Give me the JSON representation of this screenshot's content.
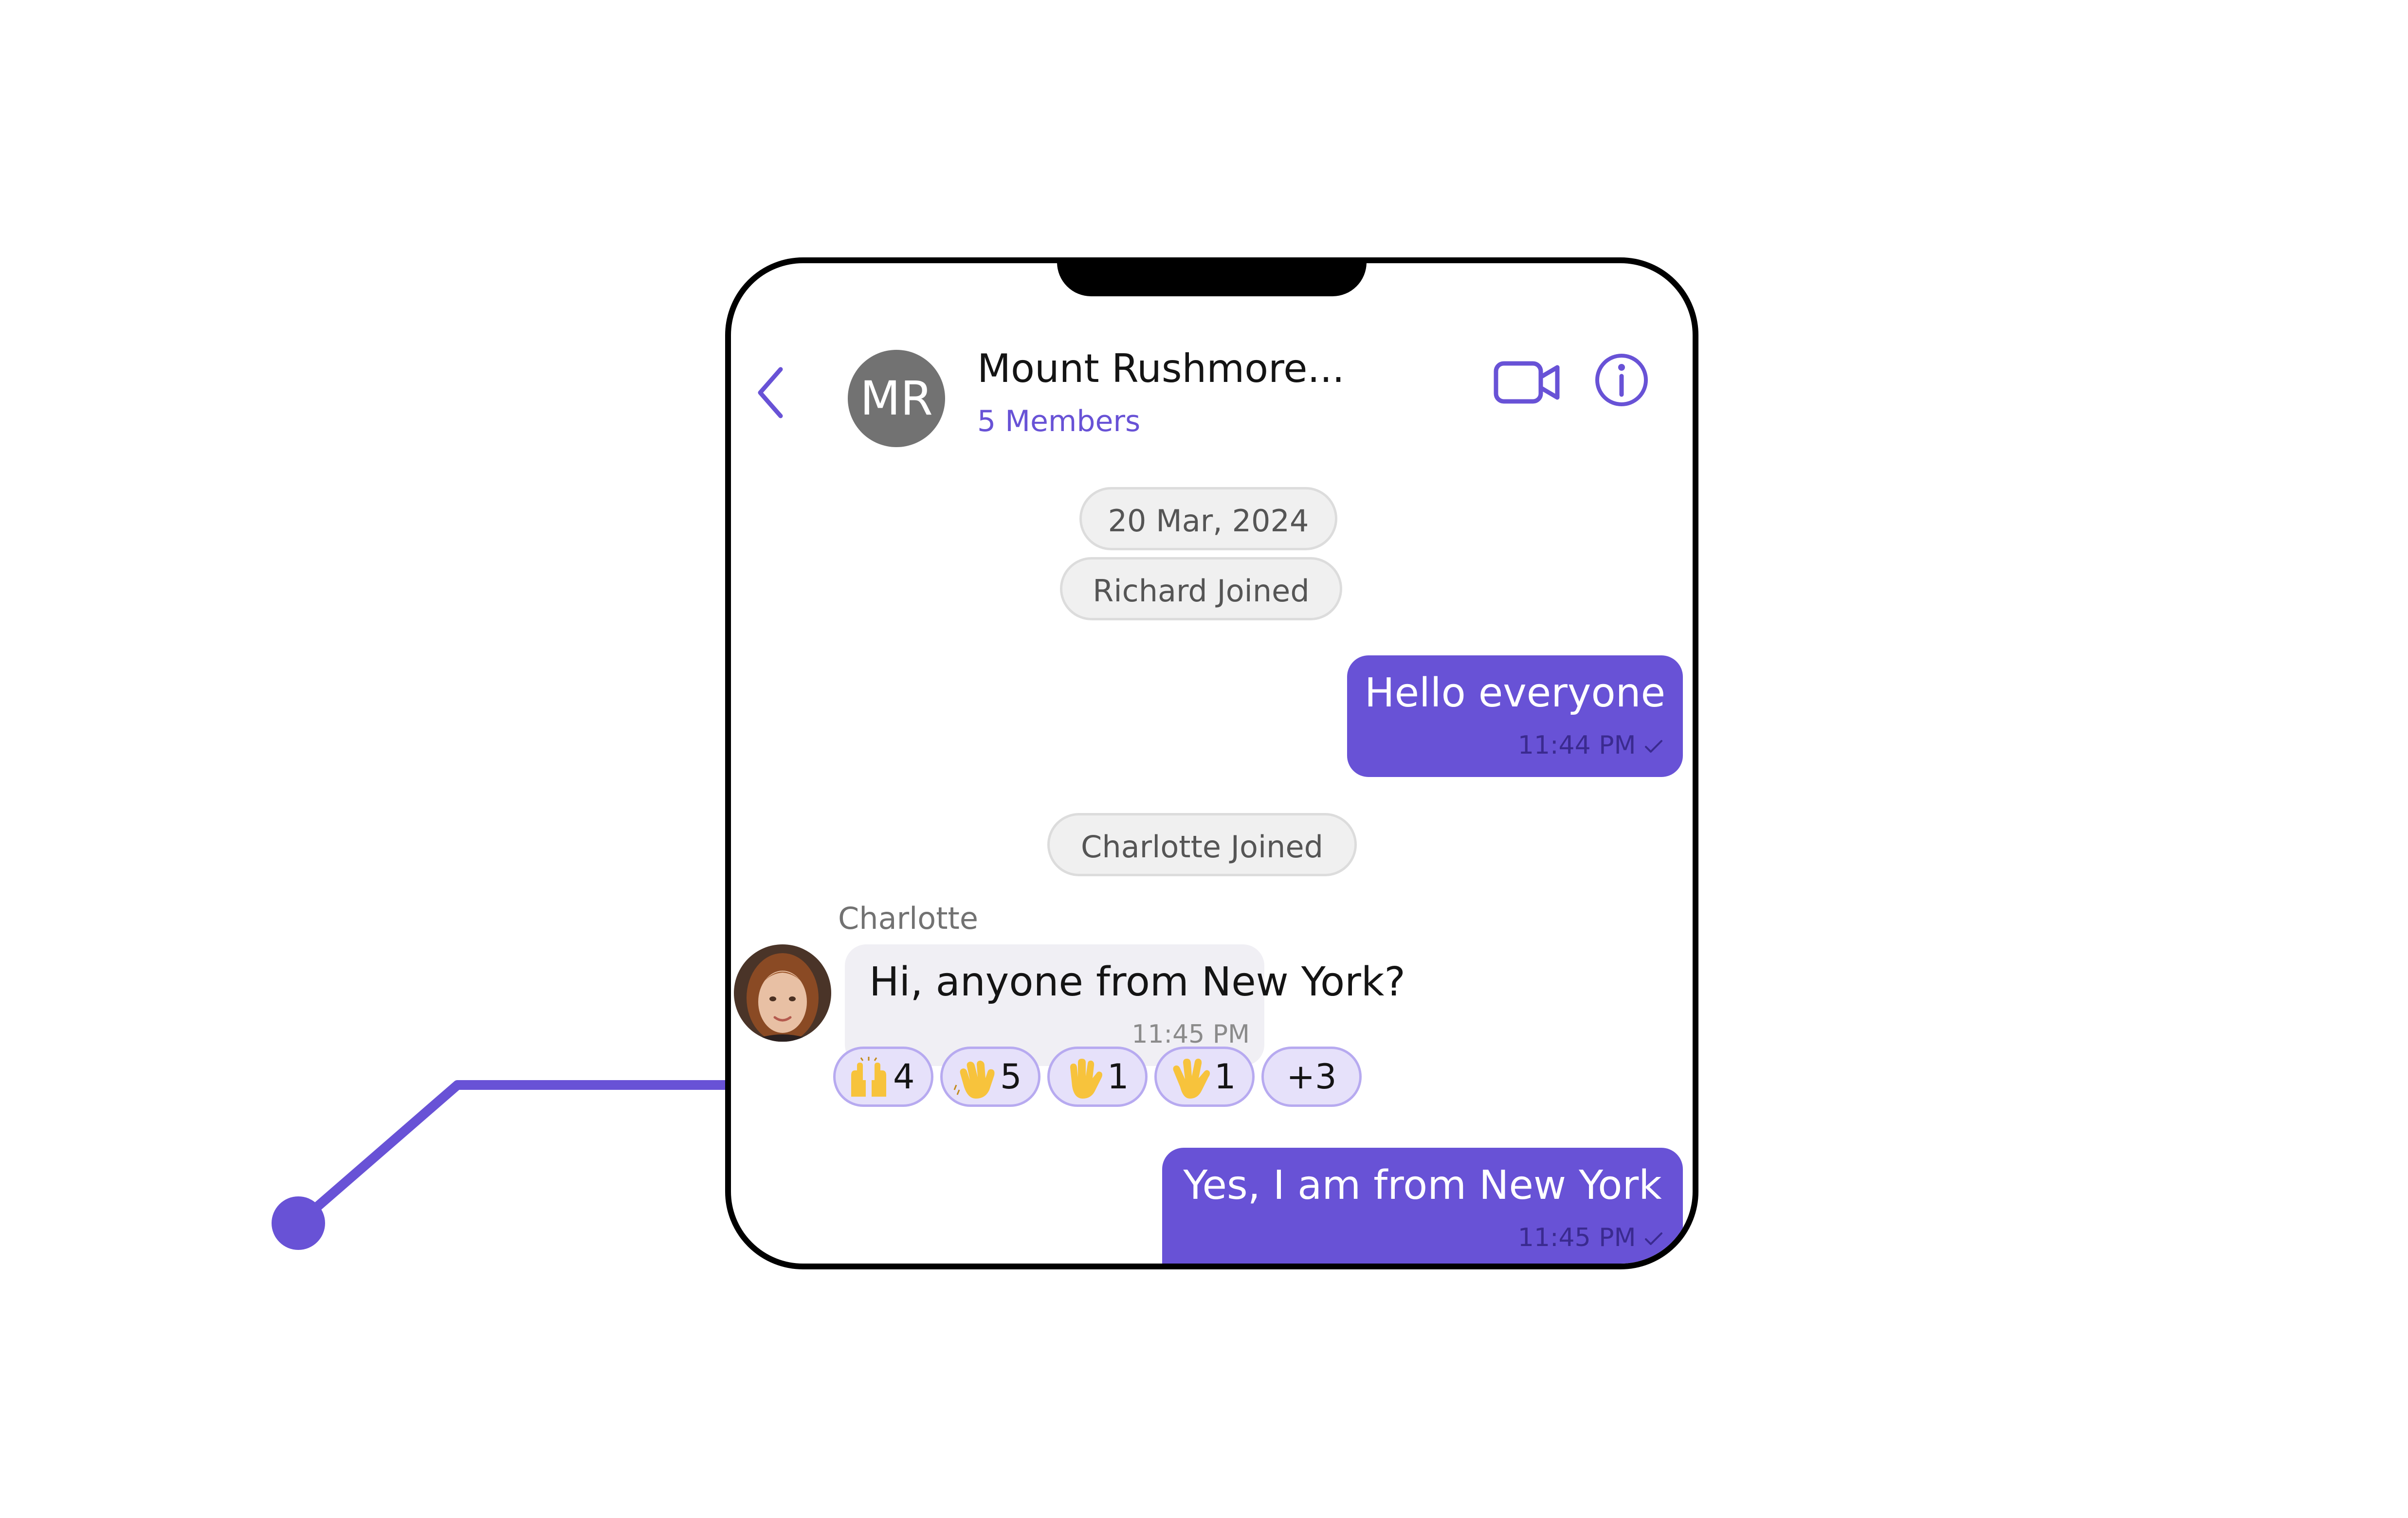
{
  "header": {
    "avatar_initials": "MR",
    "group_name": "Mount Rushmore...",
    "members": "5 Members"
  },
  "system": {
    "date": "20 Mar, 2024",
    "richard_joined": "Richard Joined",
    "charlotte_joined": "Charlotte Joined"
  },
  "messages": {
    "hello": {
      "text": "Hello everyone",
      "time": "11:44 PM"
    },
    "incoming": {
      "sender": "Charlotte",
      "text": "Hi, anyone from New York?",
      "time": "11:45 PM"
    },
    "yes": {
      "text": "Yes, I am from New York",
      "time": "11:45 PM"
    }
  },
  "reactions": [
    {
      "icon": "raising-hands-icon",
      "count": "4"
    },
    {
      "icon": "waving-hand-icon",
      "count": "5"
    },
    {
      "icon": "raised-hand-icon",
      "count": "1"
    },
    {
      "icon": "raised-hand-fingers-splayed-icon",
      "count": "1"
    }
  ],
  "reactions_more": "+3",
  "colors": {
    "accent": "#6852D6",
    "incoming_bubble": "#F0EFF4",
    "reaction_bg": "#E6E1FA"
  }
}
